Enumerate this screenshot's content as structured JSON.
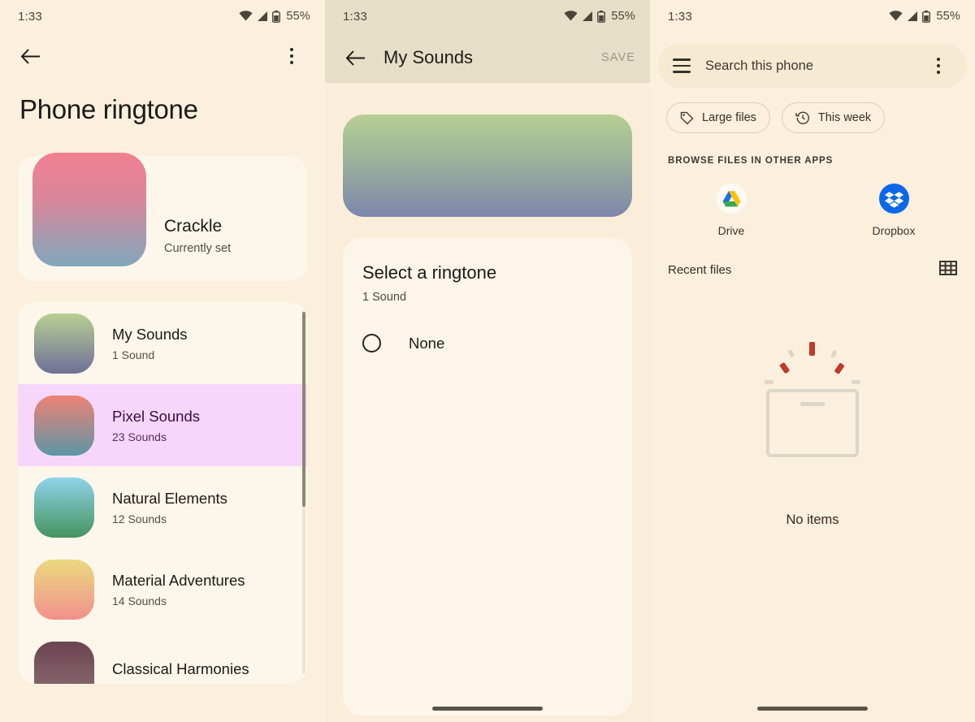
{
  "statusbar": {
    "time": "1:33",
    "battery": "55%",
    "wifi_icon": "wifi-icon",
    "signal_icon": "signal-icon",
    "battery_icon": "battery-icon"
  },
  "panel1": {
    "back_icon": "back-arrow-icon",
    "overflow_icon": "overflow-menu-icon",
    "title": "Phone ringtone",
    "current": {
      "name": "Crackle",
      "status": "Currently set",
      "thumb": "gradient-pink-blue"
    },
    "sounds": [
      {
        "name": "My Sounds",
        "count": "1 Sound",
        "selected": false,
        "gradient_from": "#b9cf94",
        "gradient_to": "#6f6f96"
      },
      {
        "name": "Pixel Sounds",
        "count": "23 Sounds",
        "selected": true,
        "gradient_from": "#ee8273",
        "gradient_to": "#5e95a6"
      },
      {
        "name": "Natural Elements",
        "count": "12 Sounds",
        "selected": false,
        "gradient_from": "#8fd3ea",
        "gradient_to": "#46935f"
      },
      {
        "name": "Material Adventures",
        "count": "14 Sounds",
        "selected": false,
        "gradient_from": "#ecd97e",
        "gradient_to": "#f0918c"
      },
      {
        "name": "Classical Harmonies",
        "count": "",
        "selected": false,
        "gradient_from": "#6b4451",
        "gradient_to": "#8e6f78"
      }
    ]
  },
  "panel2": {
    "back_icon": "back-arrow-icon",
    "title": "My Sounds",
    "save_label": "SAVE",
    "banner": "gradient-green-purple",
    "ringtone_title": "Select a ringtone",
    "ringtone_sub": "1 Sound",
    "options": [
      {
        "label": "None",
        "selected": false
      }
    ],
    "fab_icon": "plus-icon",
    "fab_color": "#7a4b9e",
    "marker_color": "#f8453f"
  },
  "panel3": {
    "menu_icon": "hamburger-menu-icon",
    "search_placeholder": "Search this phone",
    "search_value": "",
    "overflow_icon": "overflow-menu-icon",
    "chips": [
      {
        "label": "Large files",
        "icon": "tag-icon"
      },
      {
        "label": "This week",
        "icon": "history-icon"
      }
    ],
    "browse_label": "BROWSE FILES IN OTHER APPS",
    "apps": [
      {
        "label": "Drive",
        "icon": "google-drive-icon"
      },
      {
        "label": "Dropbox",
        "icon": "dropbox-icon"
      }
    ],
    "recent_label": "Recent files",
    "grid_icon": "grid-view-icon",
    "empty_icon": "empty-box-icon",
    "empty_text": "No items"
  }
}
